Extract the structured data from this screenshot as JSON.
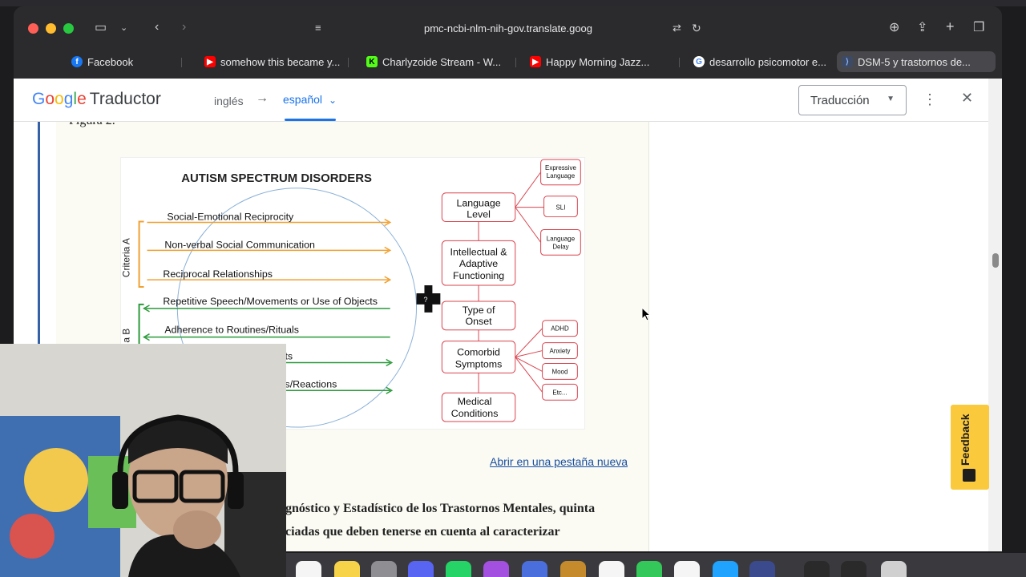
{
  "browser": {
    "url": "pmc-ncbi-nlm-nih-gov.translate.goog",
    "bookmarks": [
      {
        "label": "Facebook",
        "icon": "facebook-icon",
        "color": "#1877f2"
      },
      {
        "label": "somehow this became y...",
        "icon": "youtube-icon",
        "color": "#ff0000"
      },
      {
        "label": "Charlyzoide Stream - W...",
        "icon": "kick-icon",
        "color": "#53fc18"
      },
      {
        "label": "Happy Morning Jazz...",
        "icon": "youtube-icon",
        "color": "#ff0000"
      },
      {
        "label": "desarrollo psicomotor e...",
        "icon": "google-icon",
        "color": "#4285f4"
      },
      {
        "label": "DSM-5 y trastornos de...",
        "icon": "translate-icon",
        "color": "#8ab4f8"
      }
    ]
  },
  "translator": {
    "brand": "Google",
    "product": "Traductor",
    "source_lang": "inglés",
    "target_lang": "español",
    "mode_label": "Traducción"
  },
  "article": {
    "figure_label": "Figura 2.",
    "open_link": "Abrir en una pestaña nueva",
    "text_line_1": "gnóstico y Estadístico de los Trastornos Mentales, quinta",
    "text_line_2": "ciadas que deben tenerse en cuenta al caracterizar"
  },
  "figure": {
    "title": "AUTISM SPECTRUM DISORDERS",
    "criteria_a_label": "Criteria A",
    "criteria_b_label": "a B",
    "criteria_a_items": [
      "Social-Emotional Reciprocity",
      "Non-verbal Social Communication",
      "Reciprocal Relationships"
    ],
    "criteria_b_items": [
      "Repetitive Speech/Movements or Use of Objects",
      "Adherence to Routines/Rituals",
      "ts",
      "s/Reactions"
    ],
    "specifiers": [
      "Language Level",
      "Intellectual & Adaptive Functioning",
      "Type of Onset",
      "Comorbid Symptoms",
      "Medical Conditions"
    ],
    "language_subs": [
      "Expressive Language",
      "SLI",
      "Language Delay"
    ],
    "comorbid_subs": [
      "ADHD",
      "Anxiety",
      "Mood",
      "Etc..."
    ],
    "plus_symbol": "?"
  },
  "feedback": {
    "label": "Feedback"
  },
  "colors": {
    "criteria_a": "#f0a030",
    "criteria_b": "#2a9a3a",
    "specifier_border": "#d9434f",
    "link": "#1a4fa0",
    "feedback_bg": "#fbc93c"
  }
}
